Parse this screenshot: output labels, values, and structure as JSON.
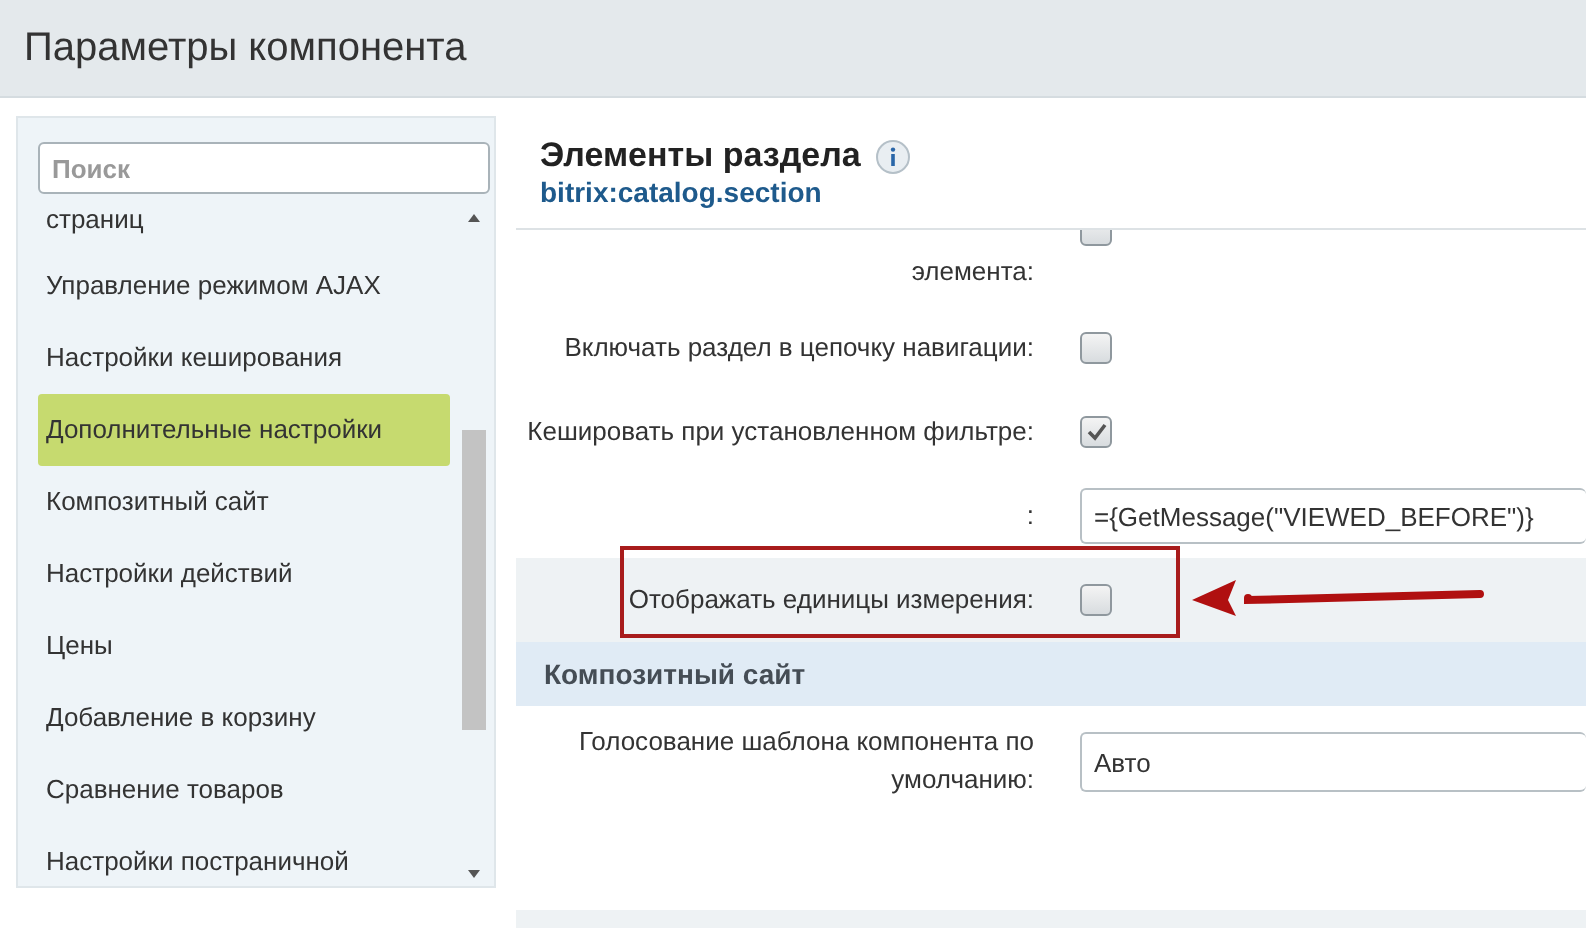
{
  "window": {
    "title": "Параметры компонента"
  },
  "sidebar": {
    "search": {
      "placeholder": "Поиск"
    },
    "items": [
      {
        "label": "страниц",
        "selected": false
      },
      {
        "label": "Управление режимом AJAX",
        "selected": false
      },
      {
        "label": "Настройки кеширования",
        "selected": false
      },
      {
        "label": "Дополнительные настройки",
        "selected": true
      },
      {
        "label": "Композитный сайт",
        "selected": false
      },
      {
        "label": "Настройки действий",
        "selected": false
      },
      {
        "label": "Цены",
        "selected": false
      },
      {
        "label": "Добавление в корзину",
        "selected": false
      },
      {
        "label": "Сравнение товаров",
        "selected": false
      },
      {
        "label": "Настройки постраничной",
        "selected": false
      }
    ]
  },
  "component": {
    "title": "Элементы раздела",
    "code": "bitrix:catalog.section"
  },
  "rows": [
    {
      "kind": "checkbox",
      "label": "элемента:",
      "checked": false,
      "highlighted": false
    },
    {
      "kind": "checkbox",
      "label": "Включать раздел в цепочку навигации:",
      "checked": false,
      "highlighted": false
    },
    {
      "kind": "checkbox",
      "label": "Кешировать при установленном фильтре:",
      "checked": true,
      "highlighted": false
    },
    {
      "kind": "text",
      "label": ":",
      "value": "={GetMessage(\"VIEWED_BEFORE\")}",
      "highlighted": false
    },
    {
      "kind": "checkbox",
      "label": "Отображать единицы измерения:",
      "checked": false,
      "highlighted": true
    },
    {
      "kind": "section",
      "label": "Композитный сайт"
    },
    {
      "kind": "select",
      "label": "Голосование шаблона компонента по умолчанию:",
      "value": "Авто",
      "highlighted": false
    }
  ]
}
